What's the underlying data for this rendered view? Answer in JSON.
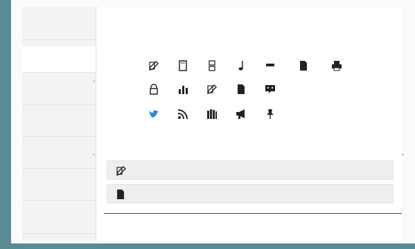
{
  "sidebar": {
    "items": [
      {
        "label": ""
      },
      {
        "label": ""
      },
      {
        "label": ""
      },
      {
        "label": ""
      },
      {
        "label": ""
      },
      {
        "label": ""
      },
      {
        "label": ""
      }
    ]
  },
  "header": {
    "title": "",
    "close": "",
    "links": [
      "",
      "",
      "",
      ""
    ]
  },
  "rows": [
    {
      "label": "",
      "tools": [
        {
          "label": "",
          "icon": "edit-icon"
        },
        {
          "label": "",
          "icon": "page-icon"
        },
        {
          "label": "",
          "icon": "music-icon"
        },
        {
          "label": "",
          "icon": "note-icon"
        },
        {
          "label": "",
          "icon": "minus-icon"
        },
        {
          "label": "",
          "icon": "file-icon"
        },
        {
          "label": "",
          "icon": "printer-icon"
        }
      ]
    },
    {
      "label": "",
      "tools": [
        {
          "label": "",
          "icon": "lock-icon"
        },
        {
          "label": "",
          "icon": "chart-icon"
        },
        {
          "label": "",
          "icon": "edit-icon"
        },
        {
          "label": "",
          "icon": "document-icon"
        },
        {
          "label": "",
          "icon": "comment-icon"
        }
      ]
    },
    {
      "label": "",
      "tools": [
        {
          "label": "",
          "icon": "twitter-icon"
        },
        {
          "label": "",
          "icon": "rss-icon"
        },
        {
          "label": "",
          "icon": "library-icon"
        },
        {
          "label": "",
          "icon": "megaphone-icon"
        },
        {
          "label": "",
          "icon": "pin-icon"
        }
      ]
    }
  ],
  "notice": "",
  "cards": [
    {
      "label": "",
      "icon": "edit-icon",
      "arrow": ""
    },
    {
      "label": "",
      "icon": "file-icon",
      "arrow": ""
    }
  ],
  "footer": {
    "link": ""
  },
  "colors": {
    "accent": "#5a8a94",
    "link": "#2a66a8",
    "twitter": "#2f8ad6"
  }
}
